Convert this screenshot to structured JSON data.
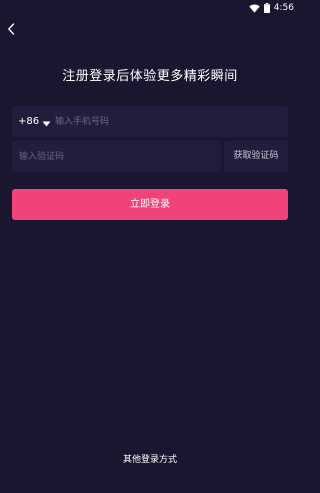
{
  "status_bar": {
    "time": "4:56",
    "wifi_icon": "wifi-icon",
    "battery_icon": "battery-icon"
  },
  "nav": {
    "back_icon": "chevron-left-icon"
  },
  "title": "注册登录后体验更多精彩瞬间",
  "phone_field": {
    "country_code": "+86",
    "dropdown_icon": "caret-down-icon",
    "placeholder": "输入手机号码",
    "value": ""
  },
  "code_field": {
    "placeholder": "输入验证码",
    "value": "",
    "get_code_label": "获取验证码"
  },
  "login_button_label": "立即登录",
  "other_login_label": "其他登录方式",
  "colors": {
    "background": "#1b1630",
    "field_background": "#231d3d",
    "accent": "#f0437a",
    "placeholder": "#6a6486"
  }
}
